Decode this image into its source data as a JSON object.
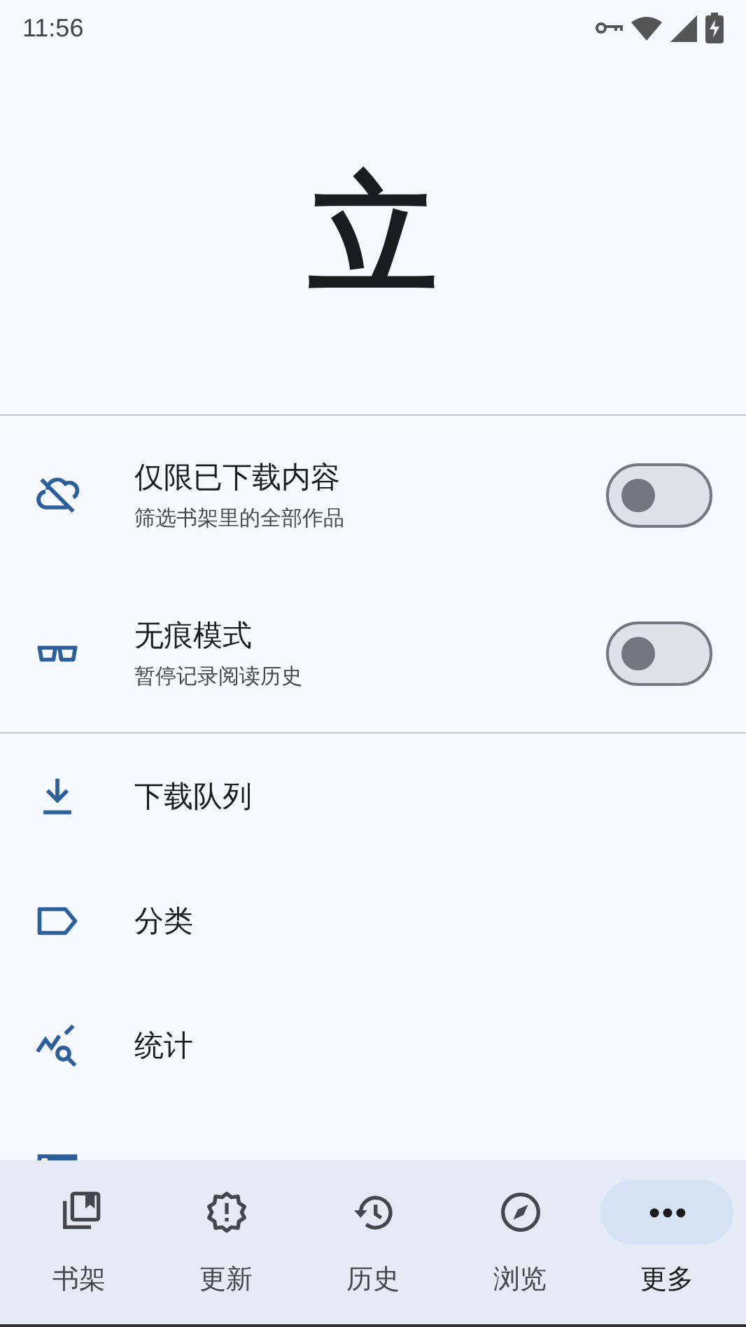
{
  "status_bar": {
    "time": "11:56"
  },
  "logo": {
    "text": "立"
  },
  "toggles": [
    {
      "kind": "cloud-off",
      "title": "仅限已下载内容",
      "subtitle": "筛选书架里的全部作品",
      "on": false
    },
    {
      "kind": "glasses",
      "title": "无痕模式",
      "subtitle": "暂停记录阅读历史",
      "on": false
    }
  ],
  "menu": [
    {
      "kind": "download",
      "label": "下载队列"
    },
    {
      "kind": "label",
      "label": "分类"
    },
    {
      "kind": "stats",
      "label": "统计"
    },
    {
      "kind": "storage"
    }
  ],
  "bottom_nav": [
    {
      "kind": "library",
      "label": "书架",
      "selected": false
    },
    {
      "kind": "updates",
      "label": "更新",
      "selected": false
    },
    {
      "kind": "history",
      "label": "历史",
      "selected": false
    },
    {
      "kind": "browse",
      "label": "浏览",
      "selected": false
    },
    {
      "kind": "more",
      "label": "更多",
      "selected": true
    }
  ]
}
